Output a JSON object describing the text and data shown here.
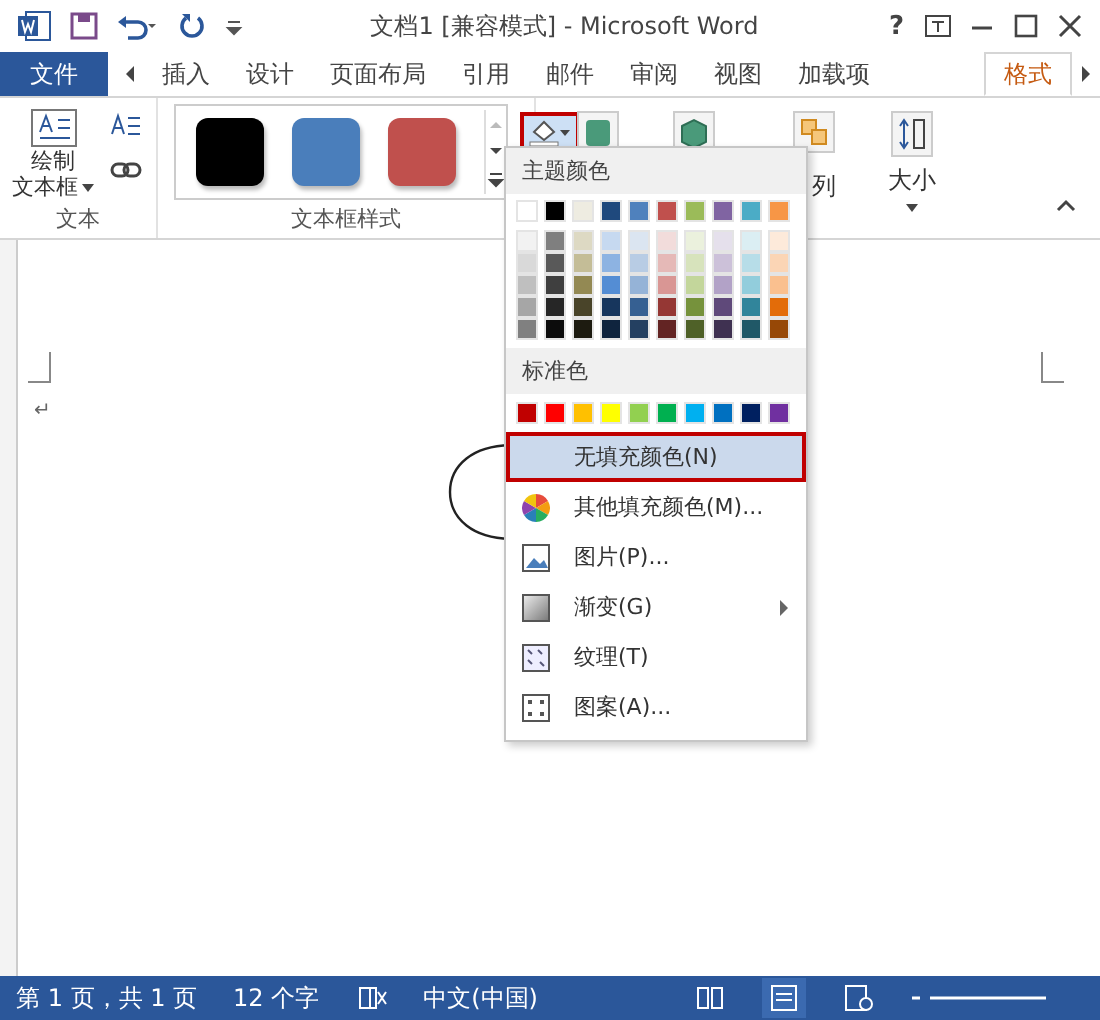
{
  "window": {
    "title": "文档1 [兼容模式] - Microsoft Word",
    "help": "?"
  },
  "tabs": [
    {
      "label": "文件",
      "kind": "file",
      "selected": false
    },
    {
      "label": "插入",
      "kind": "tab",
      "selected": false
    },
    {
      "label": "设计",
      "kind": "tab",
      "selected": false
    },
    {
      "label": "页面布局",
      "kind": "tab",
      "selected": false
    },
    {
      "label": "引用",
      "kind": "tab",
      "selected": false
    },
    {
      "label": "邮件",
      "kind": "tab",
      "selected": false
    },
    {
      "label": "审阅",
      "kind": "tab",
      "selected": false
    },
    {
      "label": "视图",
      "kind": "tab",
      "selected": false
    },
    {
      "label": "加载项",
      "kind": "tab",
      "selected": false
    },
    {
      "label": "格式",
      "kind": "tab",
      "selected": true
    }
  ],
  "ribbon": {
    "text_group": {
      "label": "文本",
      "draw_button": [
        "绘制",
        "文本框"
      ]
    },
    "style_group": {
      "label": "文本框样式",
      "styles": [
        {
          "color": "#000000"
        },
        {
          "color": "#4a7ebb"
        },
        {
          "color": "#c0504d"
        }
      ]
    },
    "fill_button": {
      "selected": true
    },
    "arrange_button": "列",
    "size_button": "大小"
  },
  "fill_menu": {
    "theme_label": "主题颜色",
    "theme_colors": [
      [
        {
          "color": "#ffffff"
        },
        {
          "color": "#000000"
        },
        {
          "color": "#eeece1"
        },
        {
          "color": "#1f497d"
        },
        {
          "color": "#4f81bd"
        },
        {
          "color": "#c0504d"
        },
        {
          "color": "#9bbb59"
        },
        {
          "color": "#8064a2"
        },
        {
          "color": "#4bacc6"
        },
        {
          "color": "#f79646"
        }
      ],
      [
        {
          "color": "#f2f2f2"
        },
        {
          "color": "#7f7f7f"
        },
        {
          "color": "#ddd9c3"
        },
        {
          "color": "#c6d9f0"
        },
        {
          "color": "#dbe5f1"
        },
        {
          "color": "#f2dcdb"
        },
        {
          "color": "#ebf1dd"
        },
        {
          "color": "#e5e0ec"
        },
        {
          "color": "#dbeef3"
        },
        {
          "color": "#fdeada"
        }
      ],
      [
        {
          "color": "#d9d9d9"
        },
        {
          "color": "#595959"
        },
        {
          "color": "#c4bd97"
        },
        {
          "color": "#8db3e2"
        },
        {
          "color": "#b8cce4"
        },
        {
          "color": "#e5b9b7"
        },
        {
          "color": "#d7e3bc"
        },
        {
          "color": "#ccc1d9"
        },
        {
          "color": "#b7dde8"
        },
        {
          "color": "#fbd5b5"
        }
      ],
      [
        {
          "color": "#bfbfbf"
        },
        {
          "color": "#3f3f3f"
        },
        {
          "color": "#938953"
        },
        {
          "color": "#548dd4"
        },
        {
          "color": "#95b3d7"
        },
        {
          "color": "#d99694"
        },
        {
          "color": "#c3d69b"
        },
        {
          "color": "#b2a2c7"
        },
        {
          "color": "#92cddc"
        },
        {
          "color": "#fac08f"
        }
      ],
      [
        {
          "color": "#a6a6a6"
        },
        {
          "color": "#262626"
        },
        {
          "color": "#494429"
        },
        {
          "color": "#17365d"
        },
        {
          "color": "#366092"
        },
        {
          "color": "#953734"
        },
        {
          "color": "#76923c"
        },
        {
          "color": "#5f497a"
        },
        {
          "color": "#31859b"
        },
        {
          "color": "#e36c09"
        }
      ],
      [
        {
          "color": "#808080"
        },
        {
          "color": "#0c0c0c"
        },
        {
          "color": "#1d1b10"
        },
        {
          "color": "#0f243e"
        },
        {
          "color": "#244061"
        },
        {
          "color": "#632423"
        },
        {
          "color": "#4f6128"
        },
        {
          "color": "#3f3151"
        },
        {
          "color": "#205867"
        },
        {
          "color": "#974806"
        }
      ]
    ],
    "standard_label": "标准色",
    "standard_colors": [
      {
        "color": "#c00000"
      },
      {
        "color": "#ff0000"
      },
      {
        "color": "#ffc000"
      },
      {
        "color": "#ffff00"
      },
      {
        "color": "#92d050"
      },
      {
        "color": "#00b050"
      },
      {
        "color": "#00b0f0"
      },
      {
        "color": "#0070c0"
      },
      {
        "color": "#002060"
      },
      {
        "color": "#7030a0"
      }
    ],
    "items": [
      {
        "label": "无填充颜色(N)",
        "kind": "none",
        "selected": true,
        "submenu": false
      },
      {
        "label": "其他填充颜色(M)...",
        "kind": "more",
        "selected": false,
        "submenu": false
      },
      {
        "label": "图片(P)...",
        "kind": "picture",
        "selected": false,
        "submenu": false
      },
      {
        "label": "渐变(G)",
        "kind": "gradient",
        "selected": false,
        "submenu": true
      },
      {
        "label": "纹理(T)",
        "kind": "texture",
        "selected": false,
        "submenu": false
      },
      {
        "label": "图案(A)...",
        "kind": "pattern",
        "selected": false,
        "submenu": false
      }
    ]
  },
  "document": {
    "paragraph_mark": "↵"
  },
  "status_bar": {
    "page": "第 1 页，共 1 页",
    "words": "12 个字",
    "language": "中文(中国)"
  }
}
